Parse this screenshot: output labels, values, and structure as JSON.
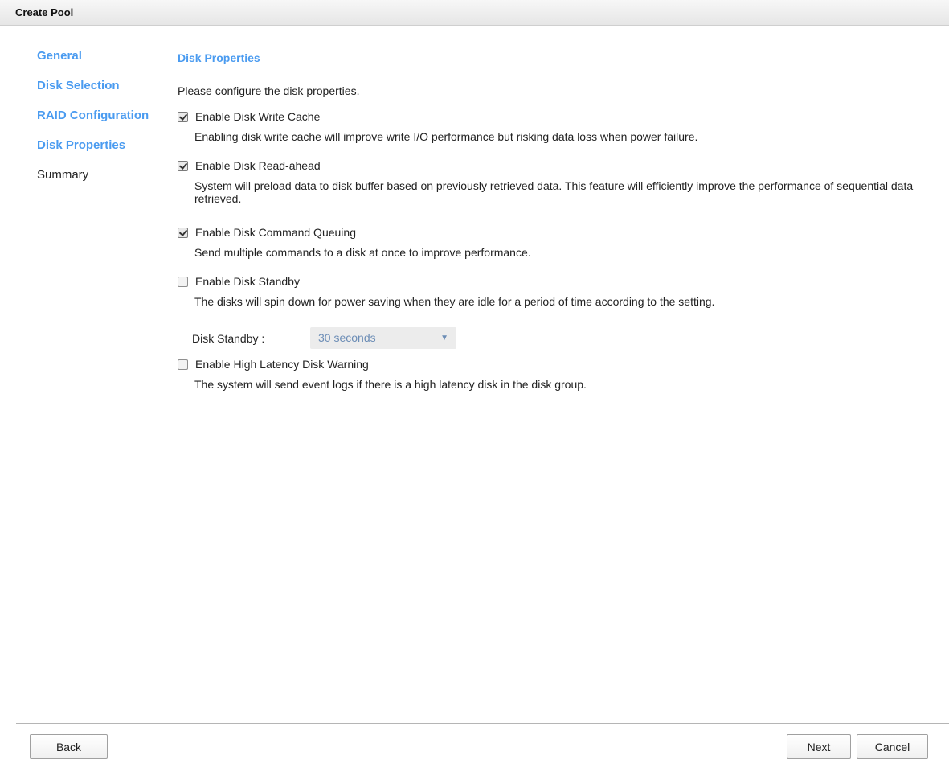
{
  "window": {
    "title": "Create Pool"
  },
  "steps": [
    {
      "label": "General"
    },
    {
      "label": "Disk Selection"
    },
    {
      "label": "RAID Configuration"
    },
    {
      "label": "Disk Properties"
    },
    {
      "label": "Summary"
    }
  ],
  "panel": {
    "title": "Disk Properties",
    "intro": "Please configure the disk properties.",
    "options": [
      {
        "label": "Enable Disk Write Cache",
        "checked": true,
        "description": "Enabling disk write cache will improve write I/O performance but risking data loss when power failure."
      },
      {
        "label": "Enable Disk Read-ahead",
        "checked": true,
        "description": "System will preload data to disk buffer based on previously retrieved data. This feature will efficiently improve the performance of sequential data retrieved."
      },
      {
        "label": "Enable Disk Command Queuing",
        "checked": true,
        "description": "Send multiple commands to a disk at once to improve performance."
      },
      {
        "label": "Enable Disk Standby",
        "checked": false,
        "description": "The disks will spin down for power saving when they are idle for a period of time according to the setting."
      },
      {
        "label": "Enable High Latency Disk Warning",
        "checked": false,
        "description": "The system will send event logs if there is a high latency disk in the disk group."
      }
    ],
    "standby": {
      "label": "Disk Standby :",
      "value": "30 seconds",
      "caret_icon": "caret-down-icon"
    }
  },
  "buttons": {
    "back": "Back",
    "next": "Next",
    "cancel": "Cancel"
  },
  "colors": {
    "accent": "#4a9bf0",
    "select_text": "#6c8db6",
    "select_bg": "#ececec"
  }
}
